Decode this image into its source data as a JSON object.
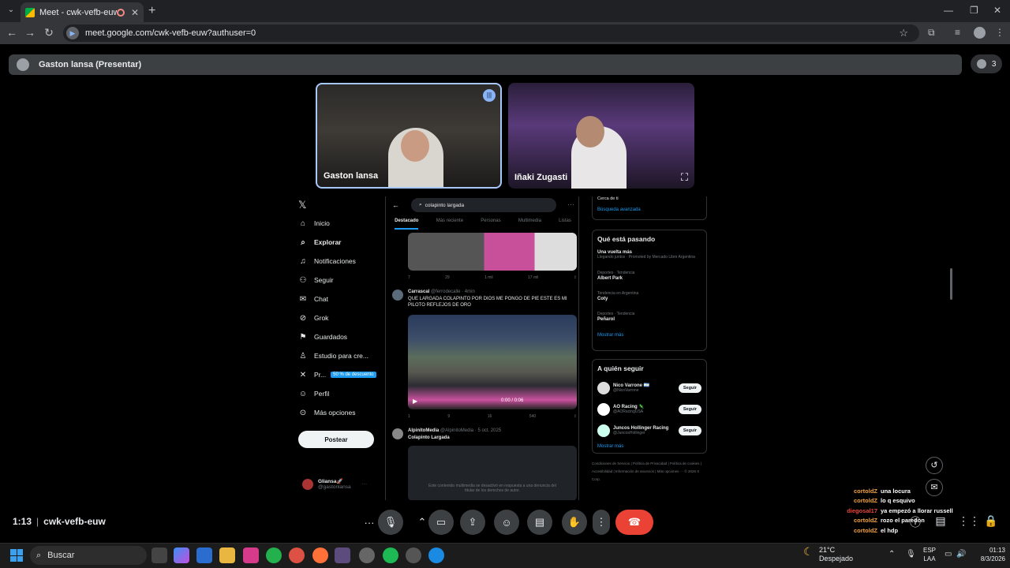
{
  "browser": {
    "tab_title": "Meet - cwk-vefb-euw",
    "url": "meet.google.com/cwk-vefb-euw?authuser=0"
  },
  "meet": {
    "presenter_label": "Gaston lansa (Presentar)",
    "participant_count": "3",
    "time": "1:13",
    "meeting_code": "cwk-vefb-euw",
    "tiles": [
      {
        "name": "Gaston lansa"
      },
      {
        "name": "Iñaki Zugasti"
      }
    ]
  },
  "x": {
    "nav": [
      {
        "icon": "home-icon",
        "label": "Inicio"
      },
      {
        "icon": "search-icon",
        "label": "Explorar"
      },
      {
        "icon": "bell-icon",
        "label": "Notificaciones"
      },
      {
        "icon": "follow-icon",
        "label": "Seguir"
      },
      {
        "icon": "mail-icon",
        "label": "Chat"
      },
      {
        "icon": "grok-icon",
        "label": "Grok"
      },
      {
        "icon": "bookmark-icon",
        "label": "Guardados"
      },
      {
        "icon": "studio-icon",
        "label": "Estudio para cre..."
      },
      {
        "icon": "x-icon",
        "label": "Pr..."
      },
      {
        "icon": "profile-icon",
        "label": "Perfil"
      },
      {
        "icon": "more-icon",
        "label": "Más opciones"
      }
    ],
    "premium_badge": "50 % de descuento",
    "post_button": "Postear",
    "user_name": "Gliansa🚀",
    "user_handle": "@gastonlansa",
    "search_query": "colapinto largada",
    "feed_tabs": [
      "Destacado",
      "Más reciente",
      "Personas",
      "Multimedia",
      "Listas"
    ],
    "stats1": [
      "7",
      "29",
      "1 mil",
      "17 mil"
    ],
    "tweet1": {
      "name": "Carrascal",
      "handle": "@ferrodecalle · 4min",
      "text": "QUE LARGADA COLAPINTO POR DIOS ME PONGO DE PIE ESTE ES MI PILOTO REFLEJOS DE ORO",
      "video_time": "0:00 / 0:06"
    },
    "stats2": [
      "1",
      "9",
      "16",
      "540"
    ],
    "tweet2": {
      "name": "AlpinitoMedia",
      "handle": "@AlpinitoMedia · 5 oct. 2025",
      "text": "Colapinto Largada",
      "media_notice": "Este contenido multimedia se desactivó en respuesta a una denuncia del titular de los derechos de autor."
    },
    "advanced_search": "Búsqueda avanzada",
    "near_you": "Cerca de ti",
    "trends_title": "Qué está pasando",
    "trends": [
      {
        "meta": "Una vuelta más",
        "title": "",
        "sub": "Llegando juntos · Promoted by Mercado Libre Argentina"
      },
      {
        "meta": "Deportes · Tendencia",
        "title": "Albert Park",
        "sub": ""
      },
      {
        "meta": "Tendencia en Argentina",
        "title": "Coty",
        "sub": ""
      },
      {
        "meta": "Deportes · Tendencia",
        "title": "Peñarol",
        "sub": ""
      }
    ],
    "show_more": "Mostrar más",
    "follow_title": "A quién seguir",
    "follow": [
      {
        "name": "Nico Varrone 🇦🇷",
        "handle": "@NicoVarrone",
        "btn": "Seguir"
      },
      {
        "name": "AO Racing 🦎",
        "handle": "@AORacingUSA",
        "btn": "Seguir"
      },
      {
        "name": "Juncos Hollinger Racing",
        "handle": "@JuncosHollinger",
        "btn": "Seguir"
      }
    ],
    "footer": "Condiciones de Servicio | Política de Privacidad | Política de cookies | Accesibilidad | Información de anuncios | Más opciones ··· © 2026 X Corp."
  },
  "chat": [
    {
      "user": "cortoldZ",
      "msg": "una locura",
      "color": "#f4a340"
    },
    {
      "user": "cortoldZ",
      "msg": "lo q esquivo",
      "color": "#f4a340"
    },
    {
      "user": "diegosal17",
      "msg": "ya empezó a llorar russell",
      "color": "#e8453c"
    },
    {
      "user": "cortoldZ",
      "msg": "rozo el paredon",
      "color": "#f4a340"
    },
    {
      "user": "cortoldZ",
      "msg": "el hdp",
      "color": "#f4a340"
    }
  ],
  "taskbar": {
    "search": "Buscar",
    "temp": "21°C",
    "weather": "Despejado",
    "lang1": "ESP",
    "lang2": "LAA",
    "time": "01:13",
    "date": "8/3/2026"
  }
}
